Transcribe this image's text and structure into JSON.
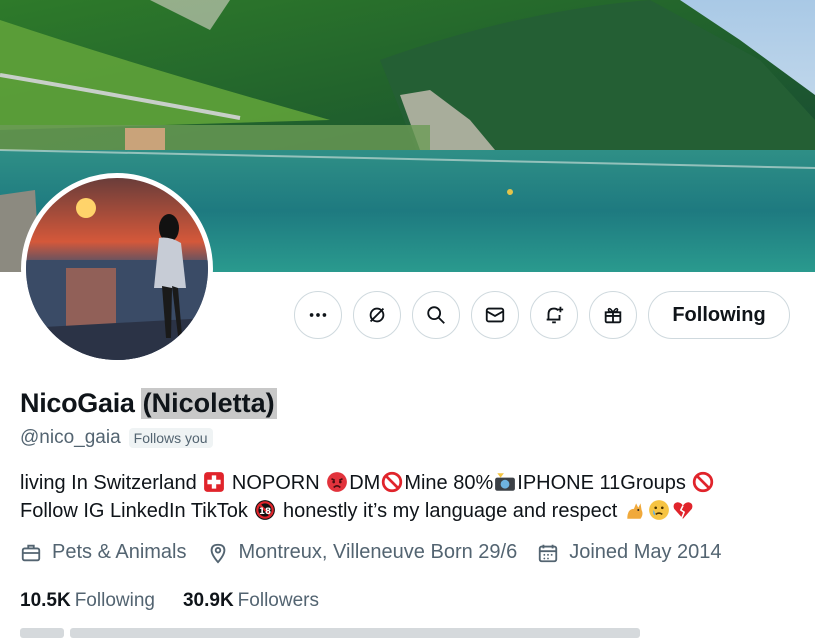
{
  "profile": {
    "display_name": "NicoGaia",
    "nickname": "(Nicoletta)",
    "handle": "@nico_gaia",
    "follows_you": "Follows you",
    "follow_button": "Following",
    "bio_line1": {
      "t1": "living In Switzerland ",
      "t2": " NOPORN ",
      "t3": "DM",
      "t4": "Mine 80%",
      "t5": "IPHONE 11Groups "
    },
    "bio_line2": {
      "t1": "Follow IG LinkedIn TikTok ",
      "t2": " honestly it’s my language and respect "
    },
    "category": "Pets & Animals",
    "location": "Montreux, Villeneuve Born 29/6",
    "joined": "Joined May 2014",
    "following_count": "10.5K",
    "following_label": "Following",
    "followers_count": "30.9K",
    "followers_label": "Followers"
  },
  "icons": {
    "more": "more-icon",
    "grok": "grok-icon",
    "search": "search-icon",
    "message": "message-icon",
    "notify": "notification-bell-icon",
    "gift": "gift-icon",
    "category": "briefcase-icon",
    "location": "location-pin-icon",
    "joined": "calendar-icon"
  },
  "colors": {
    "text": "#0f1419",
    "secondary": "#536471",
    "border": "#cfd9de"
  }
}
